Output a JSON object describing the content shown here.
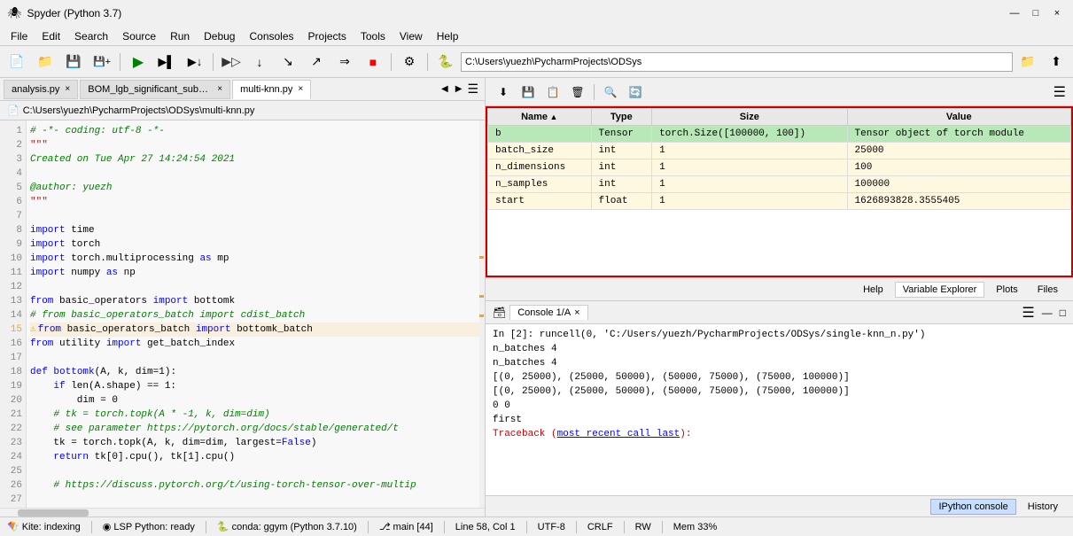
{
  "titlebar": {
    "title": "Spyder (Python 3.7)",
    "icon": "🕷"
  },
  "menubar": {
    "items": [
      "File",
      "Edit",
      "Search",
      "Source",
      "Run",
      "Debug",
      "Consoles",
      "Projects",
      "Tools",
      "View",
      "Help"
    ]
  },
  "toolbar": {
    "path": "C:\\Users\\yuezh\\PycharmProjects\\ODSys",
    "buttons": [
      "new-file",
      "open-file",
      "save",
      "save-all",
      "run",
      "run-cell",
      "debug",
      "step-over",
      "step-in",
      "step-out",
      "stop",
      "profile",
      "settings",
      "python"
    ]
  },
  "editor": {
    "file_path": "C:\\Users\\yuezh\\PycharmProjects\\ODSys\\multi-knn.py",
    "tabs": [
      {
        "label": "analysis.py",
        "active": false
      },
      {
        "label": "BOM_lgb_significant_subset_analysis_dataset.py",
        "active": false
      },
      {
        "label": "multi-knn.py",
        "active": true
      }
    ],
    "lines": [
      {
        "num": 1,
        "text": "# -*- coding: utf-8 -*-",
        "type": "comment",
        "warn": false
      },
      {
        "num": 2,
        "text": "\"\"\"",
        "type": "string",
        "warn": false
      },
      {
        "num": 3,
        "text": "Created on Tue Apr 27 14:24:54 2021",
        "type": "comment",
        "warn": false
      },
      {
        "num": 4,
        "text": "",
        "type": "normal",
        "warn": false
      },
      {
        "num": 5,
        "text": "@author: yuezh",
        "type": "comment",
        "warn": false
      },
      {
        "num": 6,
        "text": "\"\"\"",
        "type": "string",
        "warn": false
      },
      {
        "num": 7,
        "text": "",
        "type": "normal",
        "warn": false
      },
      {
        "num": 8,
        "text": "import time",
        "type": "import",
        "warn": false
      },
      {
        "num": 9,
        "text": "import torch",
        "type": "import",
        "warn": false
      },
      {
        "num": 10,
        "text": "import torch.multiprocessing as mp",
        "type": "import",
        "warn": false
      },
      {
        "num": 11,
        "text": "import numpy as np",
        "type": "import",
        "warn": false
      },
      {
        "num": 12,
        "text": "",
        "type": "normal",
        "warn": false
      },
      {
        "num": 13,
        "text": "from basic_operators import bottomk",
        "type": "import",
        "warn": false
      },
      {
        "num": 14,
        "text": "# from basic_operators_batch import cdist_batch",
        "type": "comment",
        "warn": false
      },
      {
        "num": 15,
        "text": "from basic_operators_batch import bottomk_batch",
        "type": "import",
        "warn": true
      },
      {
        "num": 16,
        "text": "from utility import get_batch_index",
        "type": "import",
        "warn": false
      },
      {
        "num": 17,
        "text": "",
        "type": "normal",
        "warn": false
      },
      {
        "num": 18,
        "text": "def bottomk(A, k, dim=1):",
        "type": "def",
        "warn": false
      },
      {
        "num": 19,
        "text": "    if len(A.shape) == 1:",
        "type": "normal",
        "warn": false
      },
      {
        "num": 20,
        "text": "        dim = 0",
        "type": "normal",
        "warn": false
      },
      {
        "num": 21,
        "text": "    # tk = torch.topk(A * -1, k, dim=dim)",
        "type": "comment",
        "warn": false
      },
      {
        "num": 22,
        "text": "    # see parameter https://pytorch.org/docs/stable/generated/t",
        "type": "comment",
        "warn": false
      },
      {
        "num": 23,
        "text": "    tk = torch.topk(A, k, dim=dim, largest=False)",
        "type": "normal",
        "warn": false
      },
      {
        "num": 24,
        "text": "    return tk[0].cpu(), tk[1].cpu()",
        "type": "normal",
        "warn": false
      },
      {
        "num": 25,
        "text": "",
        "type": "normal",
        "warn": false
      },
      {
        "num": 26,
        "text": "    # https://discuss.pytorch.org/t/using-torch-tensor-over-multip",
        "type": "comment",
        "warn": false
      },
      {
        "num": 27,
        "text": "",
        "type": "normal",
        "warn": false
      }
    ]
  },
  "variable_explorer": {
    "toolbar_buttons": [
      "import",
      "save",
      "copy",
      "delete",
      "search",
      "refresh"
    ],
    "columns": [
      "Name",
      "Type",
      "Size",
      "Value"
    ],
    "rows": [
      {
        "name": "b",
        "type": "Tensor",
        "size": "torch.Size([100000, 100])",
        "value": "Tensor object of torch module",
        "row_class": "row-b"
      },
      {
        "name": "batch_size",
        "type": "int",
        "size": "1",
        "value": "25000",
        "row_class": "row-batch"
      },
      {
        "name": "n_dimensions",
        "type": "int",
        "size": "1",
        "value": "100",
        "row_class": "row-ndim"
      },
      {
        "name": "n_samples",
        "type": "int",
        "size": "1",
        "value": "100000",
        "row_class": "row-nsamp"
      },
      {
        "name": "start",
        "type": "float",
        "size": "1",
        "value": "1626893828.3555405",
        "row_class": "row-start"
      }
    ],
    "bottom_tabs": [
      "Help",
      "Variable Explorer",
      "Plots",
      "Files"
    ],
    "active_bottom_tab": "Variable Explorer"
  },
  "console": {
    "tabs": [
      {
        "label": "Console 1/A",
        "active": true
      }
    ],
    "output": [
      {
        "text": "In [2]: runcell(0, 'C:/Users/yuezh/PycharmProjects/ODSys/single-knn_n.py')",
        "type": "prompt"
      },
      {
        "text": "n_batches 4",
        "type": "normal"
      },
      {
        "text": "n_batches 4",
        "type": "normal"
      },
      {
        "text": "[(0, 25000), (25000, 50000), (50000, 75000), (75000, 100000)]",
        "type": "normal"
      },
      {
        "text": "[(0, 25000), (25000, 50000), (50000, 75000), (75000, 100000)]",
        "type": "normal"
      },
      {
        "text": "0 0",
        "type": "normal"
      },
      {
        "text": "first",
        "type": "normal"
      },
      {
        "text": "Traceback (most recent call last):",
        "type": "error"
      }
    ],
    "bottom_tabs": [
      "IPython console",
      "History"
    ],
    "active_bottom_tab": "IPython console"
  },
  "statusbar": {
    "kite": "Kite: indexing",
    "lsp": "LSP Python: ready",
    "conda": "conda: ggym (Python 3.7.10)",
    "git": "main [44]",
    "line_col": "Line 58, Col 1",
    "encoding": "UTF-8",
    "eol": "CRLF",
    "rw": "RW",
    "mem": "Mem 33%"
  },
  "icons": {
    "new_file": "📄",
    "open_file": "📂",
    "save": "💾",
    "run": "▶",
    "debug": "🐛",
    "search": "🔍",
    "refresh": "🔄",
    "menu": "☰",
    "close": "×",
    "minimize": "—",
    "maximize": "□",
    "warning": "⚠"
  }
}
